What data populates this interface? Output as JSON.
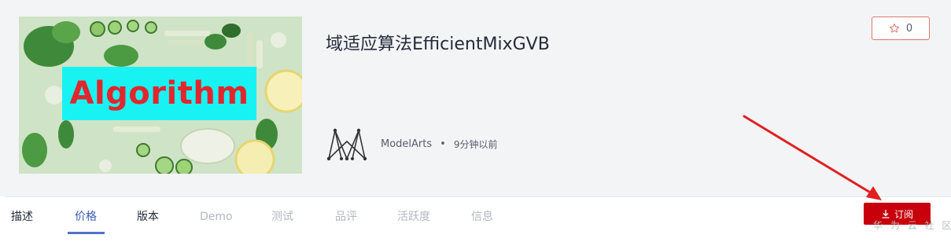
{
  "asset": {
    "title": "域适应算法EfficientMixGVB",
    "cover_label": "Algorithm",
    "author": "ModelArts",
    "separator": "•",
    "time": "9分钟以前",
    "star_count": "0"
  },
  "tabs": [
    {
      "label": "描述"
    },
    {
      "label": "价格"
    },
    {
      "label": "版本"
    },
    {
      "label": "Demo"
    },
    {
      "label": "测试"
    },
    {
      "label": "品评"
    },
    {
      "label": "活跃度"
    },
    {
      "label": "信息"
    }
  ],
  "active_tab": "价格",
  "actions": {
    "subscribe_label": "订阅"
  },
  "watermark": "华 为 云 社 区",
  "colors": {
    "accent_red": "#c7000b",
    "annotation_arrow": "#e02020",
    "active_tab": "#3b5bb5",
    "cover_label_bg": "#19f2f2",
    "cover_label_text": "#e2262d"
  },
  "icons": {
    "star": "star-outline-icon",
    "download": "download-icon",
    "author_logo": "modelarts-logo"
  }
}
